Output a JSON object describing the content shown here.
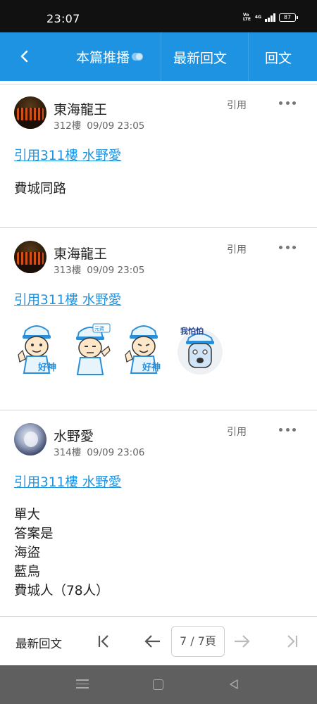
{
  "status_bar": {
    "time": "23:07",
    "volte_label": "Vo LTE",
    "network": "4G",
    "battery": "87"
  },
  "app_bar": {
    "push_label": "本篇推播",
    "latest_label": "最新回文",
    "reply_label": "回文"
  },
  "posts": [
    {
      "author": "東海龍王",
      "floor": "312樓",
      "time": "09/09 23:05",
      "quote_action": "引用",
      "quote_link": "引用311樓 水野愛",
      "body": [
        "費城同路"
      ],
      "avatar": "dragon-avatar"
    },
    {
      "author": "東海龍王",
      "floor": "313樓",
      "time": "09/09 23:05",
      "quote_action": "引用",
      "quote_link": "引用311樓 水野愛",
      "stickers": [
        {
          "icon": "thumbs-up-boy-sticker",
          "text": "好神"
        },
        {
          "icon": "salute-boy-sticker",
          "text": "元寶"
        },
        {
          "icon": "thumbs-up-boy-sticker",
          "text": "好神"
        },
        {
          "icon": "scared-boy-sticker",
          "text": "我怕怕"
        }
      ],
      "avatar": "dragon-avatar"
    },
    {
      "author": "水野愛",
      "floor": "314樓",
      "time": "09/09 23:06",
      "quote_action": "引用",
      "quote_link": "引用311樓 水野愛",
      "body": [
        "單大",
        "答案是",
        "海盜",
        "藍鳥",
        "費城人（78人）"
      ],
      "avatar": "anime-girl-avatar"
    }
  ],
  "bottom_bar": {
    "latest_label": "最新回文",
    "page_indicator": "7 / 7頁"
  },
  "colors": {
    "accent": "#1d93e2",
    "status_bar": "#111111",
    "system_nav": "#5f5f5f"
  }
}
